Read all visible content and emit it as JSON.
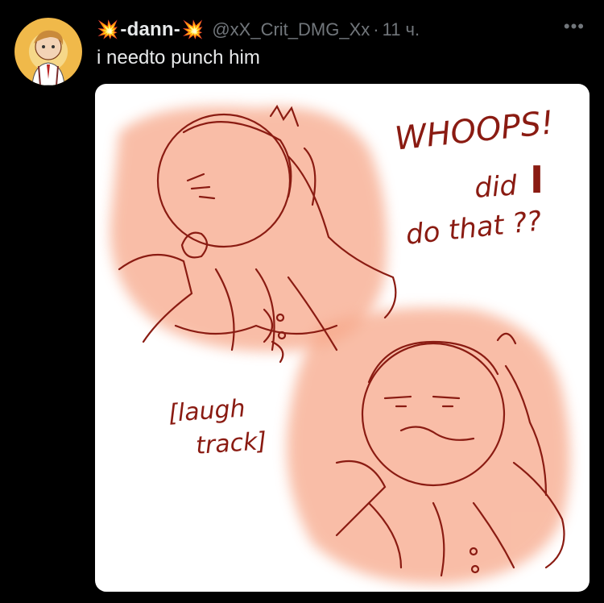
{
  "tweet": {
    "author": {
      "display_name": "-dann-",
      "emoji_left": "💥",
      "emoji_right": "💥",
      "handle": "@xX_Crit_DMG_Xx",
      "separator": "·",
      "time": "11 ч."
    },
    "more_label": "•••",
    "text": "i needto punch him",
    "media": {
      "caption_whoops": "WHOOPS!",
      "caption_did": "did",
      "caption_i": "I",
      "caption_do_that": "do that ??",
      "caption_laugh": "[laugh",
      "caption_track": "track]"
    }
  },
  "colors": {
    "background": "#000000",
    "text_primary": "#e7e9ea",
    "text_secondary": "#71767b",
    "line_art": "#8a1b12",
    "wash": "#f7a88a"
  }
}
